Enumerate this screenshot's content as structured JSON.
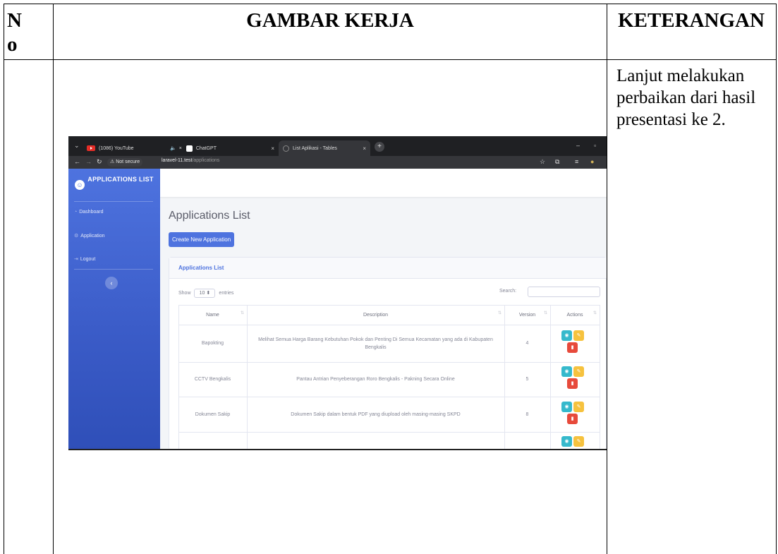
{
  "table": {
    "header": {
      "no": "No",
      "work_image": "GAMBAR KERJA",
      "description": "KETERANGAN"
    },
    "rows": [
      {
        "description_text": "Lanjut melakukan perbaikan dari hasil presentasi ke 2."
      }
    ]
  },
  "screenshot": {
    "browser": {
      "tabs": [
        {
          "title": "(1086) YouTube",
          "icon": "youtube-icon"
        },
        {
          "title": "ChatGPT",
          "icon": "chatgpt-icon"
        },
        {
          "title": "List Aplikasi - Tables",
          "icon": "loading-icon"
        }
      ],
      "security_label": "Not secure",
      "url_host": "laravel-11.test",
      "url_path": "/applications"
    },
    "sidebar": {
      "brand": "APPLICATIONS LIST",
      "items": [
        {
          "label": "Dashboard",
          "icon": "dashboard-icon"
        },
        {
          "label": "Application",
          "icon": "cogs-icon"
        },
        {
          "label": "Logout",
          "icon": "logout-icon"
        }
      ]
    },
    "page_title": "Applications List",
    "create_button": "Create New Application",
    "card_title": "Applications List",
    "show_prefix": "Show",
    "show_value": "10",
    "show_suffix": "entries",
    "search_label": "Search:",
    "columns": [
      "Name",
      "Description",
      "Version",
      "Actions"
    ],
    "rows": [
      {
        "name": "Bapokting",
        "description": "Melihat Semua Harga Barang Kebutuhan Pokok dan Penting Di Semua Kecamatan yang ada di Kabupaten Bengkalis",
        "version": "4"
      },
      {
        "name": "CCTV Bengkalis",
        "description": "Pantau Antrian Penyeberangan Roro Bengkalis - Pakning Secara Online",
        "version": "5"
      },
      {
        "name": "Dokumen Sakip",
        "description": "Dokumen Sakip dalam bentuk PDF yang diupload oleh masing-masing SKPD",
        "version": "8"
      }
    ],
    "colors": {
      "sidebar": "#4e73df",
      "view": "#36b9cc",
      "edit": "#f6c23e",
      "delete": "#e74a3b"
    }
  }
}
